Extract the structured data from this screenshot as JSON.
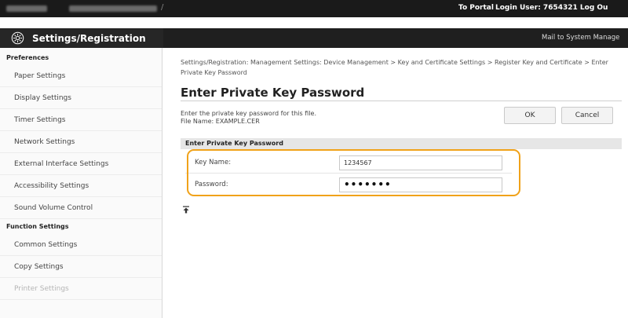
{
  "topbar": {
    "portal": "To Portal",
    "login": "Login User:  7654321  Log Ou"
  },
  "header": {
    "title": "Settings/Registration",
    "mail": "Mail to System Manage",
    "icon": "gear-icon"
  },
  "sidebar": {
    "section1": "Preferences",
    "items1": [
      "Paper Settings",
      "Display Settings",
      "Timer Settings",
      "Network Settings",
      "External Interface Settings",
      "Accessibility Settings",
      "Sound Volume Control"
    ],
    "section2": "Function Settings",
    "items2": [
      "Common Settings",
      "Copy Settings",
      "Printer Settings"
    ]
  },
  "main": {
    "breadcrumb": "Settings/Registration: Management Settings: Device Management > Key and Certificate Settings > Register Key and Certificate > Enter Private Key Password",
    "title": "Enter Private Key Password",
    "desc_line1": "Enter the private key password for this file.",
    "desc_line2": "File Name: EXAMPLE.CER",
    "ok_label": "OK",
    "cancel_label": "Cancel",
    "section_title": "Enter Private Key Password",
    "key_name_label": "Key Name:",
    "key_name_value": "1234567",
    "password_label": "Password:",
    "password_value": "•••••••",
    "highlight_color": "#f0a21a",
    "top_icon": "top-arrow-icon"
  }
}
